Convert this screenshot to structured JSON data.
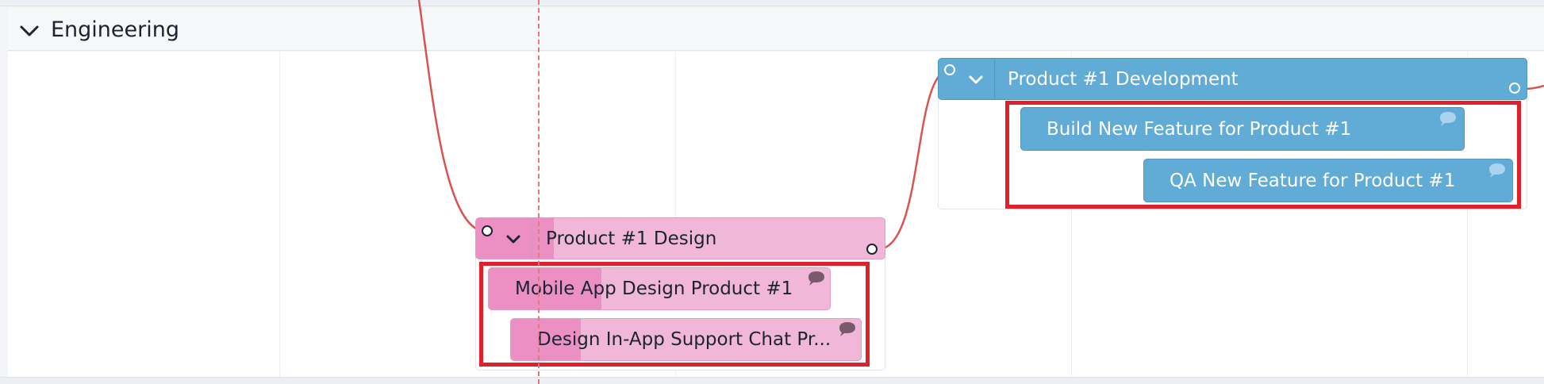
{
  "group": {
    "title": "Engineering",
    "toggle_icon": "chevron-down-icon"
  },
  "colors": {
    "blue_bar": "#61abd7",
    "pink_bar": "#f0b7d8",
    "pink_progress": "#ec90c4",
    "dependency_line": "#d9534f",
    "today_marker": "#e27a7a",
    "highlight": "#e0202a"
  },
  "timeline": {
    "groups": [
      {
        "title": "Product #1 Development",
        "color": "blue",
        "toggle_icon": "chevron-down-icon",
        "tasks": [
          {
            "title": "Build New Feature for Product #1",
            "has_comment": true
          },
          {
            "title": "QA New Feature for Product #1",
            "has_comment": true
          }
        ]
      },
      {
        "title": "Product #1 Design",
        "color": "pink",
        "toggle_icon": "chevron-down-icon",
        "progress": 0.19,
        "tasks": [
          {
            "title": "Mobile App Design Product #1",
            "has_comment": true,
            "progress": 0.33
          },
          {
            "title": "Design In-App Support Chat Pr...",
            "has_comment": true,
            "progress": 0.2
          }
        ]
      }
    ]
  }
}
